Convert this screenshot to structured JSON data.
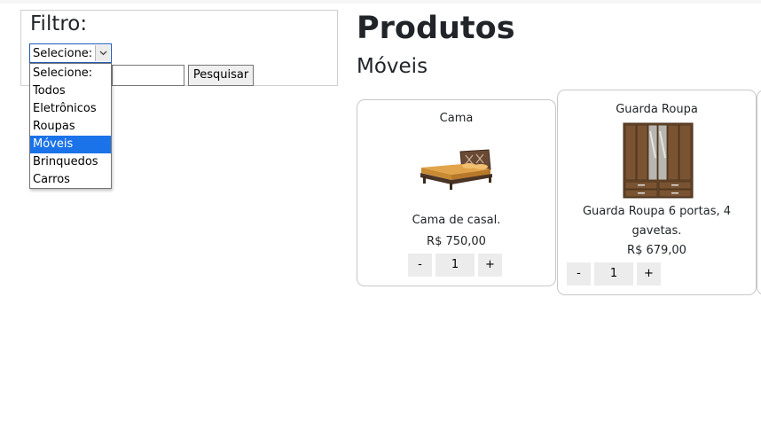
{
  "filter": {
    "title": "Filtro:",
    "select_value": "Selecione:",
    "search_value": "",
    "search_button": "Pesquisar",
    "options": [
      "Selecione:",
      "Todos",
      "Eletrônicos",
      "Roupas",
      "Móveis",
      "Brinquedos",
      "Carros"
    ],
    "highlighted_option": "Móveis"
  },
  "main": {
    "title": "Produtos",
    "category": "Móveis"
  },
  "products": [
    {
      "name": "Cama",
      "description": "Cama de casal.",
      "price": "R$ 750,00",
      "qty": "1",
      "minus": "-",
      "plus": "+",
      "image": "bed"
    },
    {
      "name": "Guarda Roupa",
      "description": "Guarda Roupa 6 portas, 4 gavetas.",
      "price": "R$ 679,00",
      "qty": "1",
      "minus": "-",
      "plus": "+",
      "image": "wardrobe"
    }
  ],
  "colors": {
    "highlight": "#1a73e8",
    "card_border": "#c8c8c8"
  }
}
